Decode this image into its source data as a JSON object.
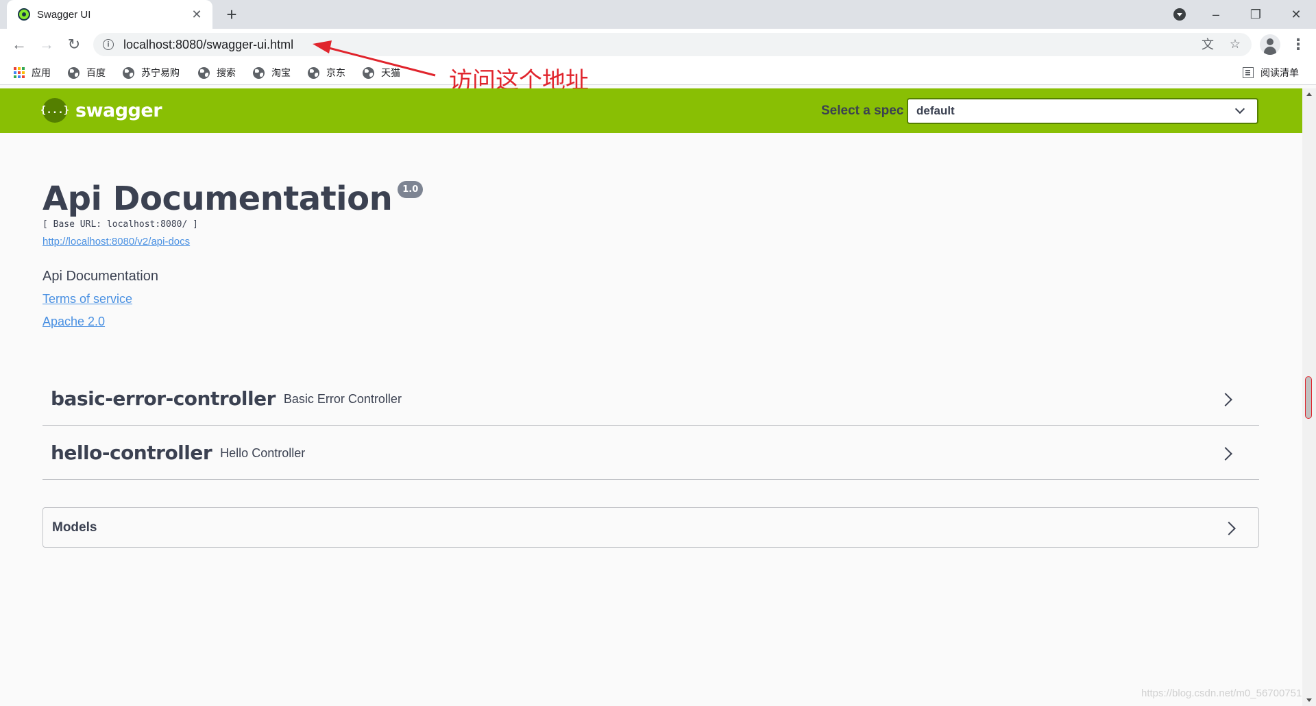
{
  "browser": {
    "tab_title": "Swagger UI",
    "url": "localhost:8080/swagger-ui.html",
    "bookmarks": [
      {
        "label": "应用",
        "icon": "apps-grid-icon"
      },
      {
        "label": "百度",
        "icon": "globe-icon"
      },
      {
        "label": "苏宁易购",
        "icon": "globe-icon"
      },
      {
        "label": "搜索",
        "icon": "globe-icon"
      },
      {
        "label": "淘宝",
        "icon": "globe-icon"
      },
      {
        "label": "京东",
        "icon": "globe-icon"
      },
      {
        "label": "天猫",
        "icon": "globe-icon"
      }
    ],
    "reading_list": "阅读清单"
  },
  "annotation": {
    "text": "访问这个地址",
    "color": "#e0242c"
  },
  "topbar": {
    "logo_text": "swagger",
    "logo_mark": "{...}",
    "spec_label": "Select a spec",
    "spec_value": "default",
    "color": "#89bf04"
  },
  "info": {
    "title": "Api Documentation",
    "version": "1.0",
    "base_url": "[ Base URL: localhost:8080/ ]",
    "api_docs_link": "http://localhost:8080/v2/api-docs",
    "description": "Api Documentation",
    "terms_of_service": "Terms of service",
    "license": "Apache 2.0"
  },
  "tags": [
    {
      "name": "basic-error-controller",
      "description": "Basic Error Controller"
    },
    {
      "name": "hello-controller",
      "description": "Hello Controller"
    }
  ],
  "models": {
    "title": "Models"
  },
  "watermark": "https://blog.csdn.net/m0_56700751"
}
